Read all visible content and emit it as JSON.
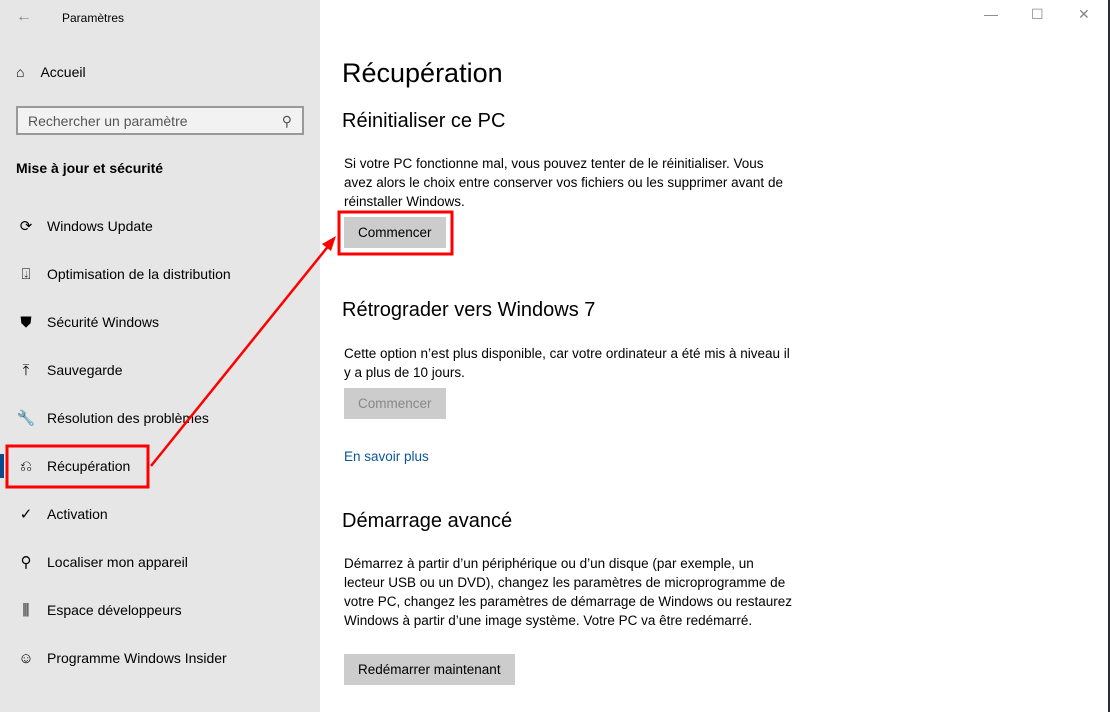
{
  "window": {
    "title": "Paramètres",
    "back_icon": "arrow-left-icon",
    "minimize": "—",
    "maximize": "☐",
    "close": "✕"
  },
  "sidebar": {
    "home": "Accueil",
    "search_placeholder": "Rechercher un paramètre",
    "section": "Mise à jour et sécurité",
    "items": [
      {
        "label": "Windows Update",
        "icon": "⟳"
      },
      {
        "label": "Optimisation de la distribution",
        "icon": "⍗"
      },
      {
        "label": "Sécurité Windows",
        "icon": "⛊"
      },
      {
        "label": "Sauvegarde",
        "icon": "⤒"
      },
      {
        "label": "Résolution des problèmes",
        "icon": "🔧"
      },
      {
        "label": "Récupération",
        "icon": "⎌"
      },
      {
        "label": "Activation",
        "icon": "✓"
      },
      {
        "label": "Localiser mon appareil",
        "icon": "⚲"
      },
      {
        "label": "Espace développeurs",
        "icon": "⫼"
      },
      {
        "label": "Programme Windows Insider",
        "icon": "☺"
      }
    ],
    "selected": "Récupération"
  },
  "main": {
    "title": "Récupération",
    "reset": {
      "heading": "Réinitialiser ce PC",
      "text": "Si votre PC fonctionne mal, vous pouvez tenter de le réinitialiser. Vous avez alors le choix entre conserver vos fichiers ou les supprimer avant de réinstaller Windows.",
      "button": "Commencer"
    },
    "downgrade": {
      "heading": "Rétrograder vers Windows 7",
      "text": "Cette option n’est plus disponible, car votre ordinateur a été mis à niveau il y a plus de 10 jours.",
      "button": "Commencer",
      "link": "En savoir plus"
    },
    "advanced": {
      "heading": "Démarrage avancé",
      "text": "Démarrez à partir d’un périphérique ou d’un disque (par exemple, un lecteur USB ou un DVD), changez les paramètres de microprogramme de votre PC, changez les paramètres de démarrage de Windows ou restaurez Windows à partir d’une image système. Votre PC va être redémarré.",
      "button": "Redémarrer maintenant"
    }
  },
  "annotation_color": "#ff0000"
}
